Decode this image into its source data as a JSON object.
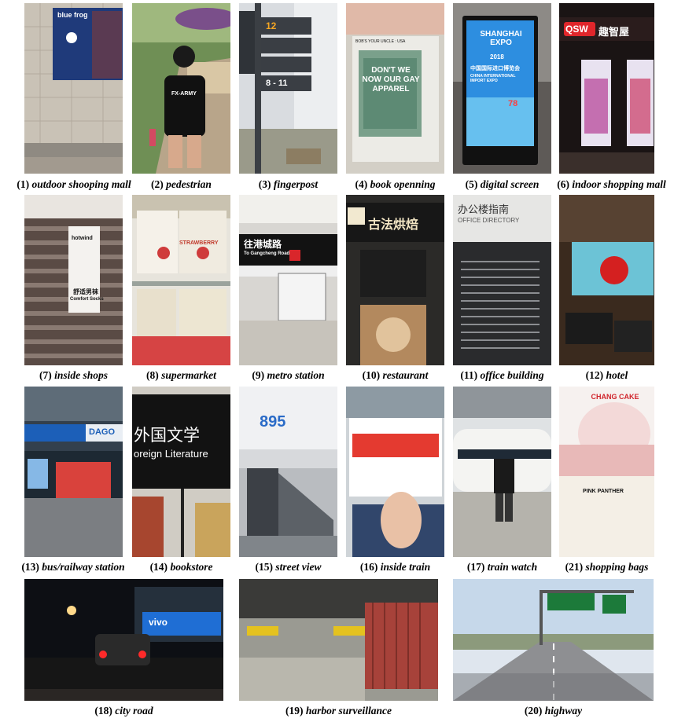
{
  "scenes": [
    {
      "num": "(1)",
      "label": "outdoor shooping mall"
    },
    {
      "num": "(2)",
      "label": "pedestrian"
    },
    {
      "num": "(3)",
      "label": "fingerpost"
    },
    {
      "num": "(4)",
      "label": "book openning"
    },
    {
      "num": "(5)",
      "label": "digital screen"
    },
    {
      "num": "(6)",
      "label": "indoor shopping mall"
    },
    {
      "num": "(7)",
      "label": "inside shops"
    },
    {
      "num": "(8)",
      "label": "supermarket"
    },
    {
      "num": "(9)",
      "label": "metro station"
    },
    {
      "num": "(10)",
      "label": "restaurant"
    },
    {
      "num": "(11)",
      "label": "office building"
    },
    {
      "num": "(12)",
      "label": "hotel"
    },
    {
      "num": "(13)",
      "label": "bus/railway station"
    },
    {
      "num": "(14)",
      "label": "bookstore"
    },
    {
      "num": "(15)",
      "label": "street view"
    },
    {
      "num": "(16)",
      "label": "inside train"
    },
    {
      "num": "(17)",
      "label": "train watch"
    },
    {
      "num": "(21)",
      "label": "shopping bags"
    },
    {
      "num": "(18)",
      "label": "city road"
    },
    {
      "num": "(19)",
      "label": "harbor surveillance"
    },
    {
      "num": "(20)",
      "label": "highway"
    }
  ],
  "photo_text": {
    "mall_sign": "blue frog",
    "shirt": "FX-ARMY",
    "post_a": "12",
    "post_b": "8 - 11",
    "book_title": "DON'T WE NOW OUR GAY APPAREL",
    "book_side": "BOB'S YOUR UNCLE : USA",
    "screen_title": "SHANGHAI EXPO",
    "screen_year": "2018",
    "screen_cn": "中国国际进口博览会",
    "screen_en": "CHINA INTERNATIONAL IMPORT EXPO",
    "screen_num": "78",
    "qsw": "QSW",
    "qsw_cn": "趣智屋",
    "sock_brand": "hotwind",
    "sock_cn": "舒适男袜",
    "sock_en": "Comfort Socks",
    "snack": "STRAWBERRY",
    "metro_cn": "往港城路",
    "metro_en": "To Gangcheng Road",
    "restaurant_cn": "古法烘焙",
    "office_cn": "办公楼指南",
    "office_en": "OFFICE DIRECTORY",
    "station_sign": "DAGO",
    "book_cn": "外国文学",
    "book_en": "oreign Literature",
    "bus_num": "895",
    "bag_brand": "CHANG CAKE",
    "bag_text": "PINK PANTHER",
    "car_brand": "vivo"
  },
  "colors": {
    "caption": "#000000",
    "background": "#ffffff"
  }
}
